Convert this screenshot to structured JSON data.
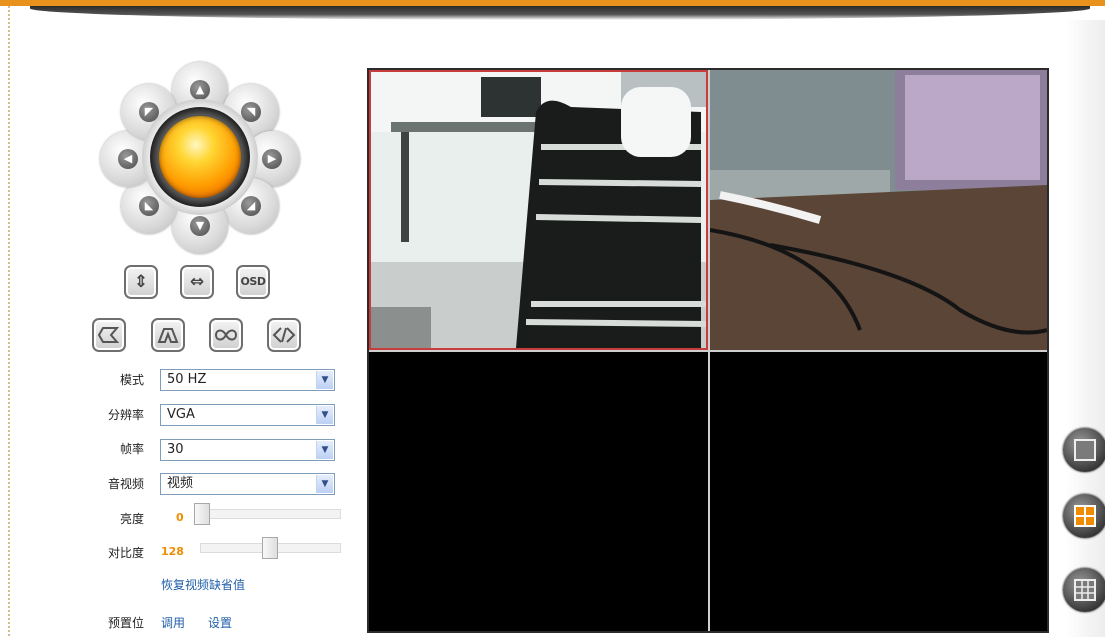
{
  "settings": {
    "mode_label": "模式",
    "mode_value": "50 HZ",
    "resolution_label": "分辨率",
    "resolution_value": "VGA",
    "framerate_label": "帧率",
    "framerate_value": "30",
    "av_label": "音视频",
    "av_value": "视频",
    "brightness_label": "亮度",
    "brightness_value": "0",
    "contrast_label": "对比度",
    "contrast_value": "128",
    "restore_defaults_link": "恢复视频缺省值",
    "preset_label": "预置位",
    "preset_call_link": "调用",
    "preset_set_link": "设置"
  },
  "controls": {
    "osd_label": "OSD",
    "vertical_flip_icon": "⇕",
    "horizontal_flip_icon": "⇔",
    "buttons": [
      "cruise-left-icon",
      "cruise-up-icon",
      "infinite-cruise-icon",
      "cruise-horizontal-icon"
    ]
  },
  "ptz": {
    "directions": [
      "up",
      "up-right",
      "right",
      "down-right",
      "down",
      "down-left",
      "left",
      "up-left"
    ]
  },
  "layout_buttons": [
    "single-view-icon",
    "quad-view-icon",
    "nine-view-icon"
  ],
  "colors": {
    "accent_orange": "#e8911c",
    "selected_cell_border": "#c83c3c",
    "link_blue": "#1f5fa8",
    "value_orange": "#f08c00"
  },
  "sliders": {
    "brightness_fraction": 0.0,
    "contrast_fraction": 0.5
  }
}
